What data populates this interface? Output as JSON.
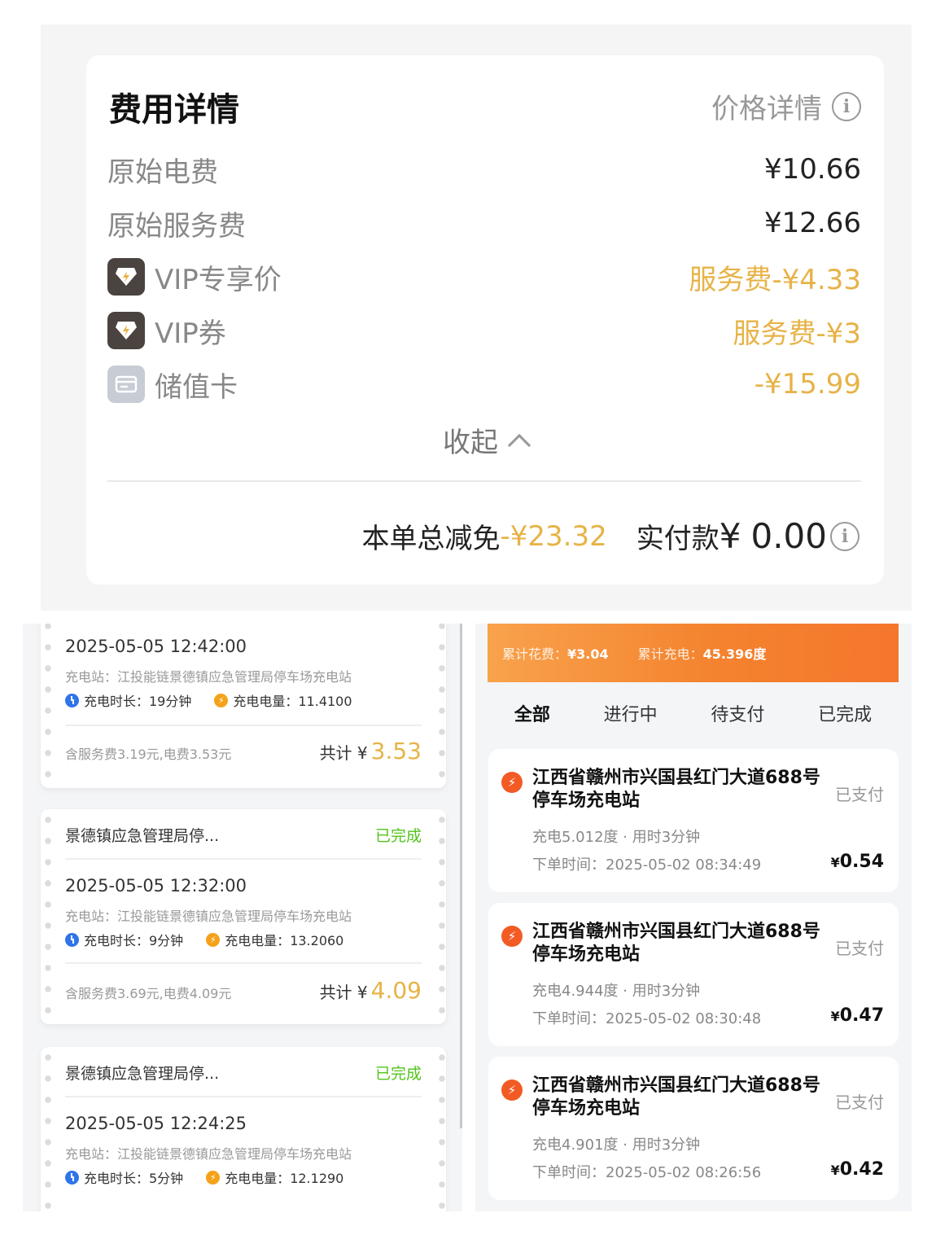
{
  "fee_detail": {
    "title": "费用详情",
    "price_detail_label": "价格详情",
    "info_glyph": "i",
    "rows": [
      {
        "label": "原始电费",
        "value": "¥10.66"
      },
      {
        "label": "原始服务费",
        "value": "¥12.66"
      },
      {
        "label": "VIP专享价",
        "value": "服务费-¥4.33",
        "icon": "vip-diamond-icon"
      },
      {
        "label": "VIP券",
        "value": "服务费-¥3",
        "icon": "vip-diamond-icon"
      },
      {
        "label": "储值卡",
        "value": "-¥15.99",
        "icon": "card-icon"
      }
    ],
    "collapse_label": "收起",
    "discount_label": "本单总减免",
    "discount_value": "-¥23.32",
    "paid_label": "实付款",
    "paid_currency": "¥",
    "paid_value": "0.00"
  },
  "orders": [
    {
      "time": "2025-05-05 12:42:00",
      "station": "充电站：江投能链景德镇应急管理局停车场充电站",
      "duration_label": "充电时长：19分钟",
      "energy_label": "充电电量：11.4100",
      "fee_note": "含服务费3.19元,电费3.53元",
      "total_label": "共计 ¥",
      "total": "3.53"
    },
    {
      "name": "景德镇应急管理局停...",
      "status": "已完成",
      "time": "2025-05-05 12:32:00",
      "station": "充电站：江投能链景德镇应急管理局停车场充电站",
      "duration_label": "充电时长：9分钟",
      "energy_label": "充电电量：13.2060",
      "fee_note": "含服务费3.69元,电费4.09元",
      "total_label": "共计 ¥",
      "total": "4.09"
    },
    {
      "name": "景德镇应急管理局停...",
      "status": "已完成",
      "time": "2025-05-05 12:24:25",
      "station": "充电站：江投能链景德镇应急管理局停车场充电站",
      "duration_label": "充电时长：5分钟",
      "energy_label": "充电电量：12.1290"
    }
  ],
  "banner": {
    "spend_label": "累计花费：",
    "spend_value": "¥3.04",
    "charge_label": "累计充电：",
    "charge_value": "45.396度"
  },
  "tabs": [
    "全部",
    "进行中",
    "待支付",
    "已完成"
  ],
  "records": [
    {
      "title": "江西省赣州市兴国县红门大道688号停车场充电站",
      "status": "已支付",
      "usage": "充电5.012度 · 用时3分钟",
      "time": "下单时间：2025-05-02 08:34:49",
      "currency": "¥",
      "amount": "0.54"
    },
    {
      "title": "江西省赣州市兴国县红门大道688号停车场充电站",
      "status": "已支付",
      "usage": "充电4.944度 · 用时3分钟",
      "time": "下单时间：2025-05-02 08:30:48",
      "currency": "¥",
      "amount": "0.47"
    },
    {
      "title": "江西省赣州市兴国县红门大道688号停车场充电站",
      "status": "已支付",
      "usage": "充电4.901度 · 用时3分钟",
      "time": "下单时间：2025-05-02 08:26:56",
      "currency": "¥",
      "amount": "0.42"
    }
  ],
  "colors": {
    "accent_gold": "#e7b347",
    "status_green": "#52c41a",
    "banner_orange": "#f4832f",
    "icon_red": "#f25b24"
  }
}
